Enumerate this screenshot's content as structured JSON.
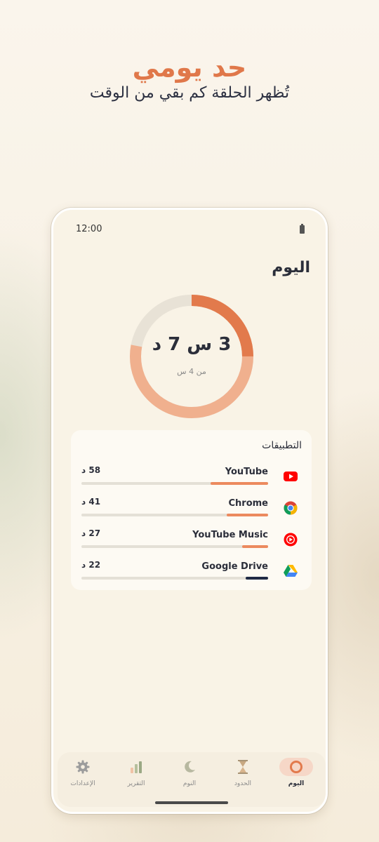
{
  "promo": {
    "headline": "حد يومي",
    "subhead": "تُظهر الحلقة كم بقي من الوقت"
  },
  "status_bar": {
    "time": "12:00"
  },
  "screen": {
    "title": "اليوم",
    "ring": {
      "main_text": "3 س 7 د",
      "sub_text": "من 4 س",
      "used_fraction": 0.78,
      "colors": {
        "track": "#e8e2d6",
        "fill_light": "#f0b08e",
        "fill_dark": "#e27a4c"
      }
    },
    "apps_title": "التطبيقات",
    "apps": [
      {
        "name": "YouTube",
        "time": "58 د",
        "icon": "youtube-icon",
        "usage_fraction": 0.31,
        "color": "#ec8a5e"
      },
      {
        "name": "Chrome",
        "time": "41 د",
        "icon": "chrome-icon",
        "usage_fraction": 0.22,
        "color": "#ec8a5e"
      },
      {
        "name": "YouTube Music",
        "time": "27 د",
        "icon": "youtube-music-icon",
        "usage_fraction": 0.14,
        "color": "#ec8a5e"
      },
      {
        "name": "Google Drive",
        "time": "22 د",
        "icon": "google-drive-icon",
        "usage_fraction": 0.12,
        "color": "#1f2a44"
      }
    ]
  },
  "nav": [
    {
      "label": "اليوم",
      "icon": "ring-icon",
      "active": true
    },
    {
      "label": "الحدود",
      "icon": "hourglass-icon",
      "active": false
    },
    {
      "label": "النوم",
      "icon": "moon-icon",
      "active": false
    },
    {
      "label": "التقرير",
      "icon": "bar-chart-icon",
      "active": false
    },
    {
      "label": "الإعدادات",
      "icon": "gear-icon",
      "active": false
    }
  ]
}
